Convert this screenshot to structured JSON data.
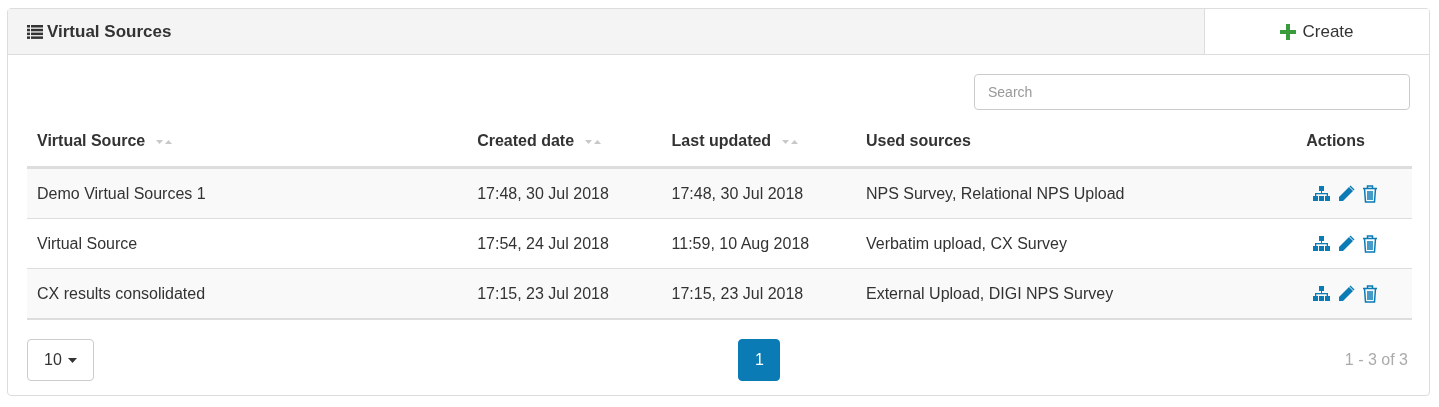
{
  "panel": {
    "title": "Virtual Sources",
    "create_button": "Create"
  },
  "search": {
    "placeholder": "Search"
  },
  "table": {
    "columns": [
      {
        "label": "Virtual Source",
        "sortable": true
      },
      {
        "label": "Created date",
        "sortable": true
      },
      {
        "label": "Last updated",
        "sortable": true
      },
      {
        "label": "Used sources",
        "sortable": false
      },
      {
        "label": "Actions",
        "sortable": false
      }
    ],
    "rows": [
      {
        "name": "Demo Virtual Sources 1",
        "created": "17:48, 30 Jul 2018",
        "updated": "17:48, 30 Jul 2018",
        "sources": "NPS Survey, Relational NPS Upload"
      },
      {
        "name": "Virtual Source",
        "created": "17:54, 24 Jul 2018",
        "updated": "11:59, 10 Aug 2018",
        "sources": "Verbatim upload, CX Survey"
      },
      {
        "name": "CX results consolidated",
        "created": "17:15, 23 Jul 2018",
        "updated": "17:15, 23 Jul 2018",
        "sources": "External Upload, DIGI NPS Survey"
      }
    ]
  },
  "footer": {
    "page_size": "10",
    "pages": [
      {
        "label": "1",
        "selected": true
      }
    ],
    "range": "1 - 3 of 3"
  }
}
